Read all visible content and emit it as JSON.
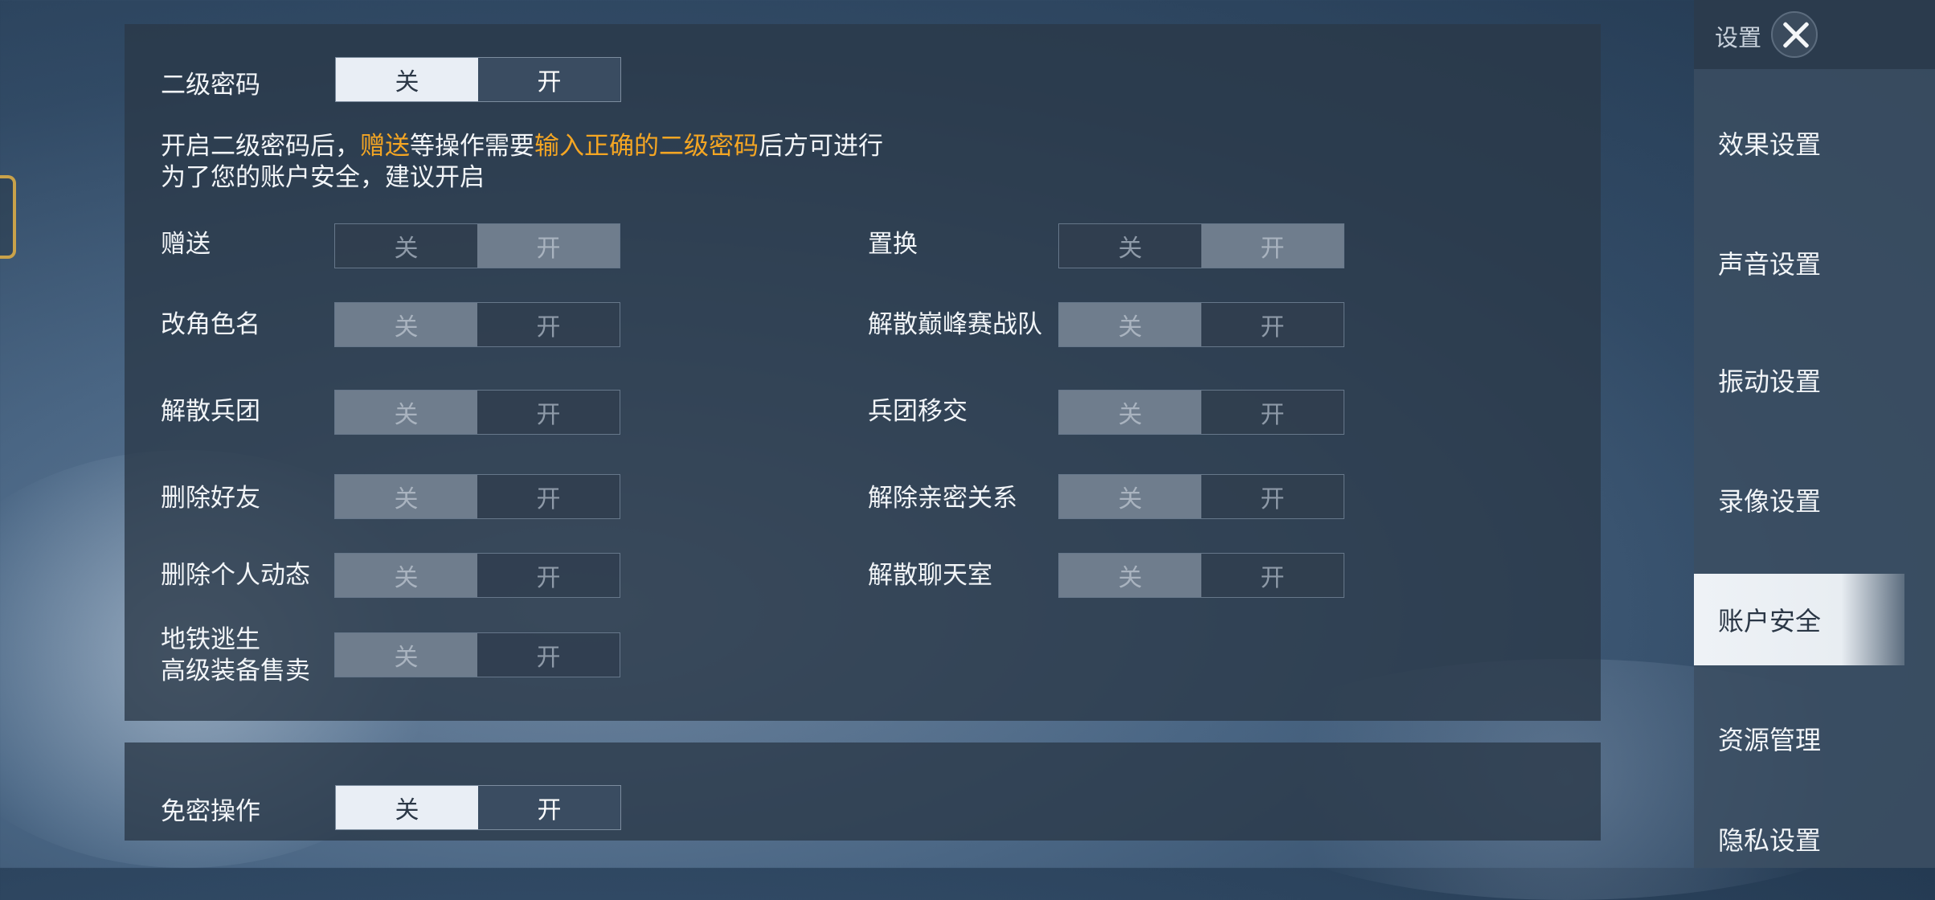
{
  "second_password": {
    "label": "二级密码",
    "off": "关",
    "on": "开",
    "desc_line1_part1": "开启二级密码后，",
    "desc_line1_hl1": "赠送",
    "desc_line1_part2": "等操作需要",
    "desc_line1_hl2": "输入正确的二级密码",
    "desc_line1_part3": "后方可进行",
    "desc_line2": "为了您的账户安全，建议开启"
  },
  "options": [
    {
      "label": "赠送",
      "off": "关",
      "on": "开"
    },
    {
      "label": "置换",
      "off": "关",
      "on": "开"
    },
    {
      "label": "改角色名",
      "off": "关",
      "on": "开"
    },
    {
      "label": "解散巅峰赛战队",
      "off": "关",
      "on": "开"
    },
    {
      "label": "解散兵团",
      "off": "关",
      "on": "开"
    },
    {
      "label": "兵团移交",
      "off": "关",
      "on": "开"
    },
    {
      "label": "删除好友",
      "off": "关",
      "on": "开"
    },
    {
      "label": "解除亲密关系",
      "off": "关",
      "on": "开"
    },
    {
      "label": "删除个人动态",
      "off": "关",
      "on": "开"
    },
    {
      "label": "解散聊天室",
      "off": "关",
      "on": "开"
    },
    {
      "label_line1": "地铁逃生",
      "label_line2": "高级装备售卖",
      "off": "关",
      "on": "开"
    }
  ],
  "no_password": {
    "label": "免密操作",
    "off": "关",
    "on": "开"
  },
  "sidebar": {
    "title": "设置",
    "items": [
      "效果设置",
      "声音设置",
      "振动设置",
      "录像设置",
      "账户安全",
      "资源管理",
      "隐私设置"
    ],
    "active": "账户安全"
  },
  "colors": {
    "highlight": "#f5a623",
    "panel": "#2a3848"
  }
}
